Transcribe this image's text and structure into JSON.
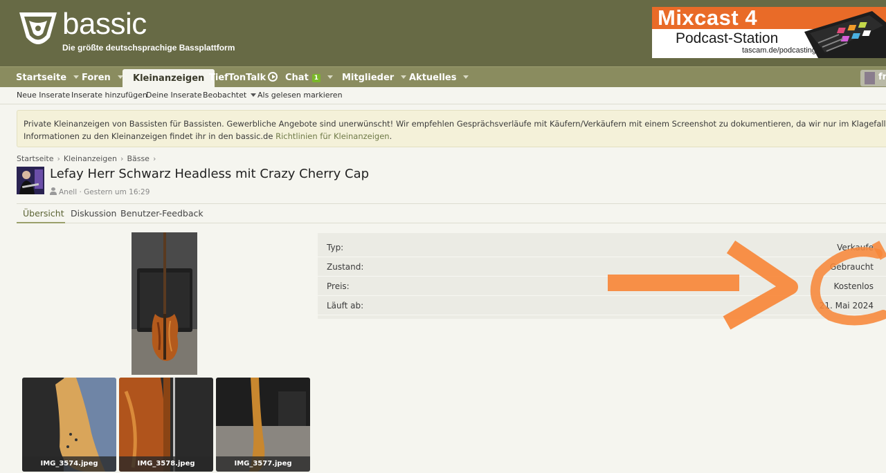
{
  "header": {
    "brand": "bassic",
    "tagline": "Die größte deutschsprachige Bassplattform",
    "ad": {
      "title": "Mixcast 4",
      "subtitle": "Podcast-Station",
      "url": "tascam.de/podcasting",
      "accent_color": "#e96b28"
    }
  },
  "nav": {
    "items": [
      {
        "label": "Startseite",
        "has_menu": true
      },
      {
        "label": "Foren",
        "has_menu": true
      },
      {
        "label": "Kleinanzeigen",
        "active": true
      },
      {
        "label": "TiefTonTalk",
        "icon": "play-circle-icon"
      },
      {
        "label": "Chat",
        "badge": "1",
        "has_menu": true
      },
      {
        "label": "Mitglieder",
        "has_menu": true
      },
      {
        "label": "Aktuelles",
        "has_menu": true
      }
    ],
    "user_label": "fr"
  },
  "subnav": {
    "items": [
      "Neue Inserate",
      "Inserate hinzufügen",
      "Deine Inserate",
      "Beobachtet",
      "Als gelesen markieren"
    ]
  },
  "notice": {
    "line1": "Private Kleinanzeigen von Bassisten für Bassisten. Gewerbliche Angebote sind unerwünscht! Wir empfehlen Gesprächsverläufe mit Käufern/Verkäufern mit einem Screenshot zu dokumentieren, da wir nur im Klagefall Auszüge aus Gesprächsverläufen herausgeben",
    "line2_prefix": "Informationen zu den Kleinanzeigen findet ihr in den bassic.de ",
    "line2_link": "Richtlinien für Kleinanzeigen",
    "line2_suffix": "."
  },
  "breadcrumb": [
    "Startseite",
    "Kleinanzeigen",
    "Bässe"
  ],
  "listing": {
    "title": "Lefay Herr Schwarz Headless mit Crazy Cherry Cap",
    "author": "Anell",
    "date": "Gestern um 16:29"
  },
  "tabs": [
    "Übersicht",
    "Diskussion",
    "Benutzer-Feedback"
  ],
  "thumbnails": [
    "IMG_3574.jpeg",
    "IMG_3578.jpeg",
    "IMG_3577.jpeg"
  ],
  "specs": [
    {
      "key": "Typ:",
      "value": "Verkaufe"
    },
    {
      "key": "Zustand:",
      "value": "Gebraucht"
    },
    {
      "key": "Preis:",
      "value": "Kostenlos"
    },
    {
      "key": "Läuft ab:",
      "value": "21. Mai 2024"
    }
  ],
  "colors": {
    "header_bg": "#676a45",
    "nav_bg": "#8a8c5f",
    "annotation": "#f7873a"
  }
}
